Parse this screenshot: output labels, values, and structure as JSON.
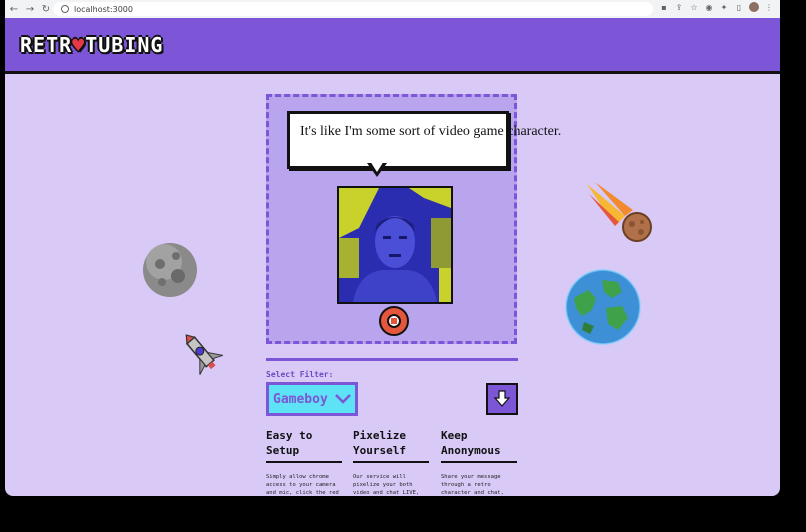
{
  "browser": {
    "url": "localhost:3000",
    "nav_back_icon": "←",
    "nav_forward_icon": "→",
    "nav_reload_icon": "↻"
  },
  "header": {
    "logo_left": "RETR",
    "logo_heart": "♥",
    "logo_right": "TUBING"
  },
  "stage": {
    "caption": "It's like I'm some sort of video game character."
  },
  "controls": {
    "filter_label": "Select Filter:",
    "filter_value": "Gameboy"
  },
  "features": [
    {
      "title": "Easy to\nSetup",
      "text": "Simply allow chrome access to your camera and mic, click the red record button and you will"
    },
    {
      "title": "Pixelize\nYourself",
      "text": "Our service will pixelize your both video and chat LIVE, allowing you to preview the results as you"
    },
    {
      "title": "Keep\nAnonymous",
      "text": "Share your message through a retro character and chat, allowing you to keep your identity and"
    }
  ],
  "colors": {
    "header_bg": "#7c56d6",
    "page_bg": "#d9c9f7",
    "record": "#e4573d",
    "filter_bg": "#5de3f5"
  }
}
